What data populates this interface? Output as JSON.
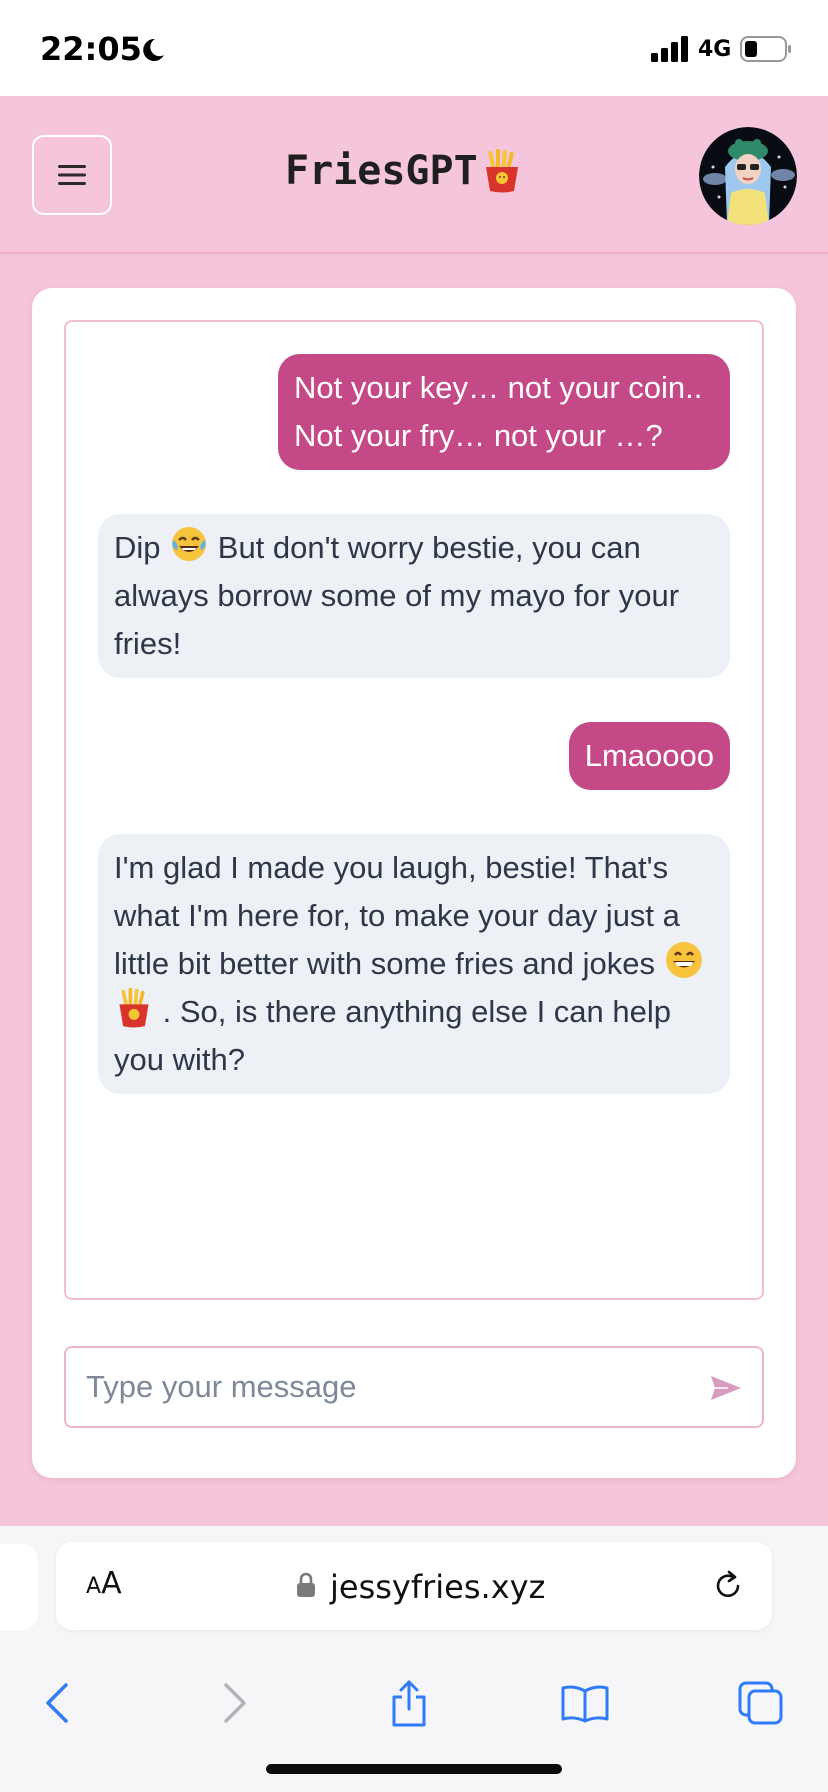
{
  "status_bar": {
    "time": "22:05",
    "network": "4G",
    "icons": [
      "moon-icon",
      "signal-icon",
      "battery-icon"
    ]
  },
  "header": {
    "title": "FriesGPT",
    "title_emoji": "fries-emoji",
    "menu_icon": "hamburger-icon",
    "avatar": "user-avatar"
  },
  "chat": {
    "messages": [
      {
        "role": "user",
        "text": "Not your key… not your coin.. Not your fry… not your …?"
      },
      {
        "role": "bot",
        "text_before": "Dip",
        "emoji": "laughing-tears-emoji",
        "text_after": "But don't worry bestie, you can always borrow some of my mayo for your fries!"
      },
      {
        "role": "user",
        "text": "Lmaoooo"
      },
      {
        "role": "bot",
        "text_before": "I'm glad I made you laugh, bestie! That's what I'm here for, to make your day just a little bit better with some fries and jokes",
        "emojis": [
          "grinning-emoji",
          "fries-emoji"
        ],
        "text_after": ". So, is there anything else I can help you with?"
      }
    ],
    "input_placeholder": "Type your message",
    "send_icon": "send-icon"
  },
  "browser": {
    "text_size_small": "A",
    "text_size_big": "A",
    "url": "jessyfries.xyz",
    "toolbar": [
      "back-icon",
      "forward-icon",
      "share-icon",
      "bookmarks-icon",
      "tabs-icon"
    ]
  },
  "colors": {
    "page_background": "#f5c6db",
    "user_bubble": "#c44a87",
    "bot_bubble": "#edf0f5",
    "ios_blue": "#2f7cf6"
  }
}
